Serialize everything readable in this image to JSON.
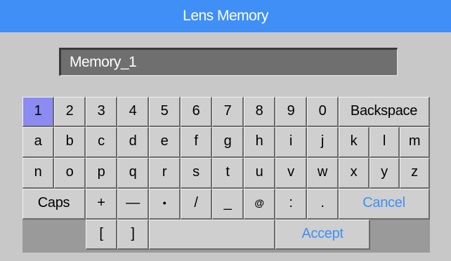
{
  "window": {
    "title": "Lens Memory"
  },
  "input": {
    "value": "Memory_1"
  },
  "keyboard": {
    "row1": [
      "1",
      "2",
      "3",
      "4",
      "5",
      "6",
      "7",
      "8",
      "9",
      "0"
    ],
    "backspace": "Backspace",
    "row2": [
      "a",
      "b",
      "c",
      "d",
      "e",
      "f",
      "g",
      "h",
      "i",
      "j",
      "k",
      "l",
      "m"
    ],
    "row3": [
      "n",
      "o",
      "p",
      "q",
      "r",
      "s",
      "t",
      "u",
      "v",
      "w",
      "x",
      "y",
      "z"
    ],
    "caps": "Caps",
    "row4_symbols": [
      "+",
      "—",
      "•",
      "/",
      "_",
      "@",
      ":",
      "."
    ],
    "cancel": "Cancel",
    "row5_brackets": [
      "[",
      "]"
    ],
    "accept": "Accept",
    "selected_key": "1"
  },
  "colors": {
    "title_bar": "#3f8ff7",
    "selected_key": "#8b8bf2",
    "action_text": "#3f8ff7"
  }
}
